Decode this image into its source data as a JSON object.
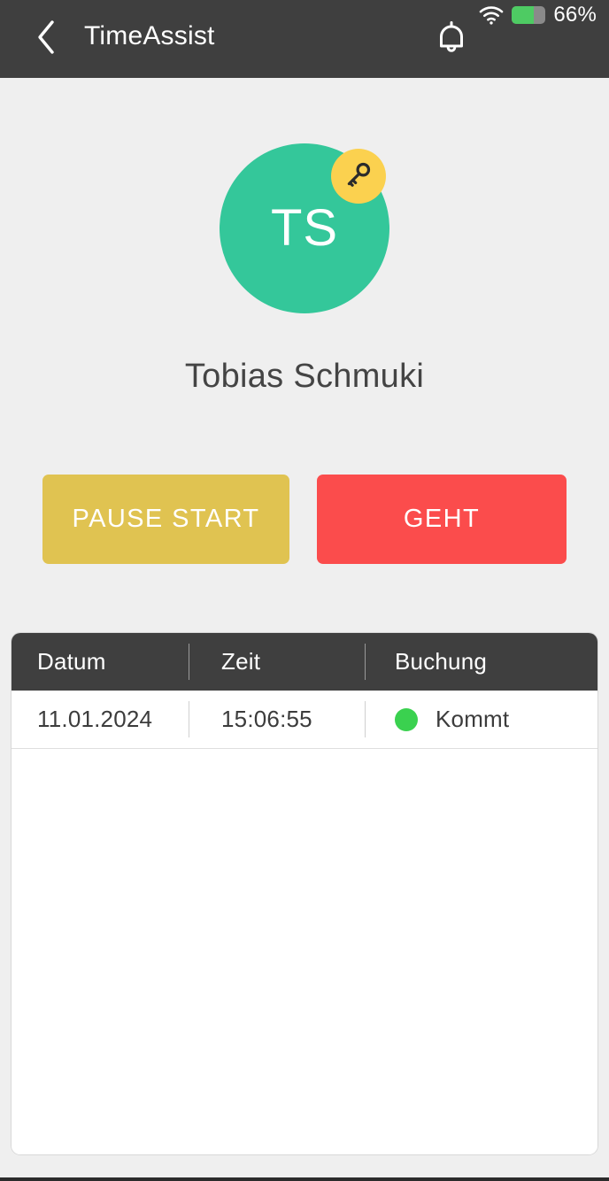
{
  "appbar": {
    "title": "TimeAssist",
    "back_icon": "chevron-left-icon",
    "bell_icon": "bell-icon",
    "status": {
      "wifi_icon": "wifi-icon",
      "battery_icon": "battery-icon",
      "battery_percent": "66%",
      "battery_level": 66
    }
  },
  "profile": {
    "initials": "TS",
    "name": "Tobias Schmuki",
    "badge_icon": "key-icon",
    "avatar_color": "#34c79a",
    "badge_color": "#fbd14f"
  },
  "actions": {
    "pause_label": "PAUSE START",
    "pause_color": "#e0c351",
    "geht_label": "GEHT",
    "geht_color": "#fb4c4c"
  },
  "table": {
    "columns": [
      "Datum",
      "Zeit",
      "Buchung"
    ],
    "rows": [
      {
        "datum": "11.01.2024",
        "zeit": "15:06:55",
        "buchung": "Kommt",
        "status_color": "#3ad14f"
      }
    ]
  }
}
